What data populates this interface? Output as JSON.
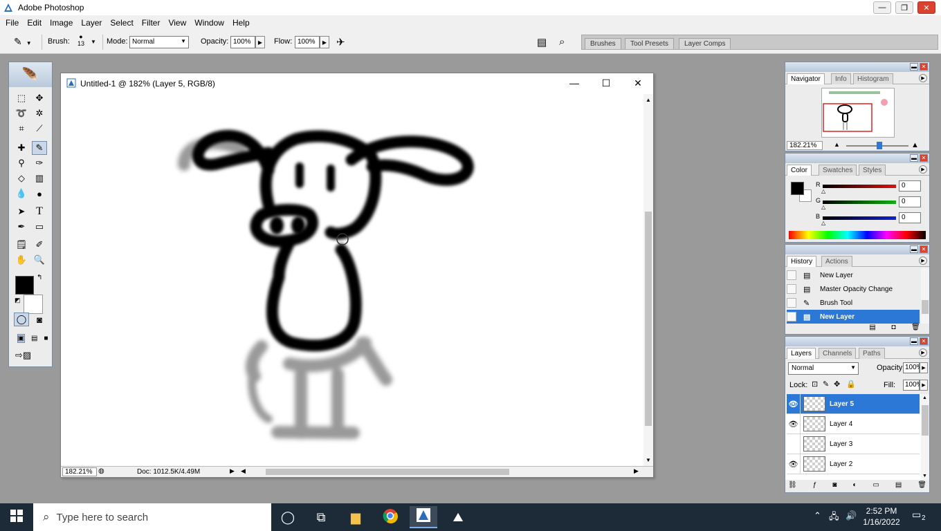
{
  "app": {
    "title": "Adobe Photoshop"
  },
  "menu": [
    "File",
    "Edit",
    "Image",
    "Layer",
    "Select",
    "Filter",
    "View",
    "Window",
    "Help"
  ],
  "options": {
    "brush_label": "Brush:",
    "brush_size": "13",
    "mode_label": "Mode:",
    "mode_value": "Normal",
    "opacity_label": "Opacity:",
    "opacity_value": "100%",
    "flow_label": "Flow:",
    "flow_value": "100%"
  },
  "palette_well": [
    "Brushes",
    "Tool Presets",
    "Layer Comps"
  ],
  "document": {
    "title": "Untitled-1 @ 182% (Layer 5, RGB/8)",
    "zoom": "182.21%",
    "doc_info": "Doc: 1012.5K/4.49M"
  },
  "navigator": {
    "tabs": [
      "Navigator",
      "Info",
      "Histogram"
    ],
    "zoom": "182.21%"
  },
  "color": {
    "tabs": [
      "Color",
      "Swatches",
      "Styles"
    ],
    "channels": [
      {
        "label": "R",
        "value": "0",
        "color": "#e01010"
      },
      {
        "label": "G",
        "value": "0",
        "color": "#10b010"
      },
      {
        "label": "B",
        "value": "0",
        "color": "#1020d0"
      }
    ]
  },
  "history": {
    "tabs": [
      "History",
      "Actions"
    ],
    "items": [
      "New Layer",
      "Master Opacity Change",
      "Brush Tool",
      "New Layer"
    ],
    "selected_index": 3
  },
  "layers": {
    "tabs": [
      "Layers",
      "Channels",
      "Paths"
    ],
    "blend_mode": "Normal",
    "opacity_label": "Opacity:",
    "opacity_value": "100%",
    "lock_label": "Lock:",
    "fill_label": "Fill:",
    "fill_value": "100%",
    "items": [
      {
        "name": "Layer 5",
        "visible": true,
        "selected": true
      },
      {
        "name": "Layer 4",
        "visible": true,
        "selected": false
      },
      {
        "name": "Layer 3",
        "visible": false,
        "selected": false
      },
      {
        "name": "Layer 2",
        "visible": true,
        "selected": false
      }
    ]
  },
  "taskbar": {
    "search_placeholder": "Type here to search",
    "time": "2:52 PM",
    "date": "1/16/2022",
    "notifications": "2"
  },
  "colors": {
    "accent": "#2b78d6",
    "taskbar": "#1d2a38",
    "workspace": "#9a9a9a"
  }
}
